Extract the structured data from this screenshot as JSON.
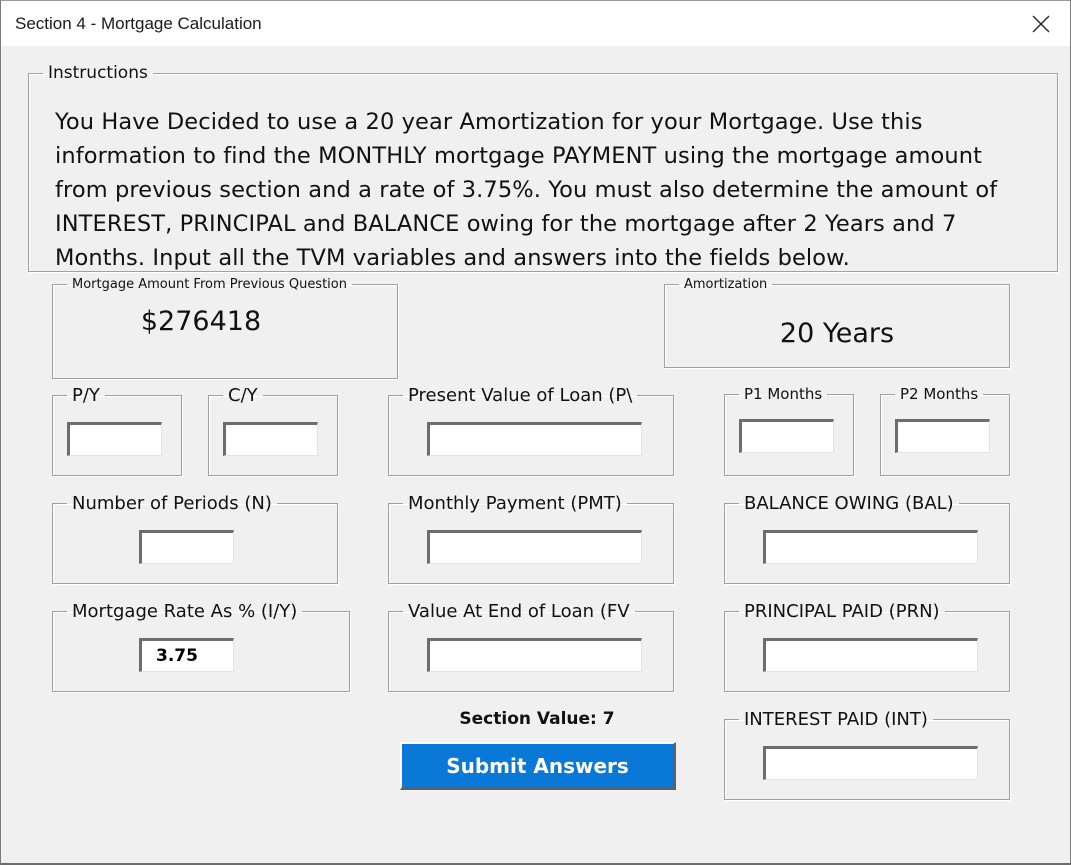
{
  "window": {
    "title": "Section 4 - Mortgage Calculation",
    "close_icon": "close-x-icon"
  },
  "instructions": {
    "legend": "Instructions",
    "lines": [
      "You Have Decided to use a 20 year Amortization for your Mortgage. Use this",
      "information to find the MONTHLY mortgage PAYMENT using the mortgage amount",
      "from previous section and a rate of 3.75%. You must also determine the amount of",
      "INTEREST, PRINCIPAL and BALANCE owing for the mortgage after 2 Years and 7",
      "Months. Input all the TVM variables and answers into the fields below."
    ]
  },
  "mortgage_amount": {
    "legend": "Mortgage Amount From Previous Question",
    "value": "$276418"
  },
  "amortization": {
    "legend": "Amortization",
    "value": "20 Years"
  },
  "fields": {
    "py": {
      "legend": "P/Y",
      "value": ""
    },
    "cy": {
      "legend": "C/Y",
      "value": ""
    },
    "pv": {
      "legend": "Present Value of Loan (P\\",
      "value": ""
    },
    "p1": {
      "legend": "P1 Months",
      "value": ""
    },
    "p2": {
      "legend": "P2 Months",
      "value": ""
    },
    "n": {
      "legend": "Number of Periods (N)",
      "value": ""
    },
    "pmt": {
      "legend": "Monthly Payment (PMT)",
      "value": ""
    },
    "bal": {
      "legend": "BALANCE OWING (BAL)",
      "value": ""
    },
    "iy": {
      "legend": "Mortgage Rate As % (I/Y)",
      "value": "3.75"
    },
    "fv": {
      "legend": "Value At End of Loan (FV",
      "value": ""
    },
    "prn": {
      "legend": "PRINCIPAL PAID  (PRN)",
      "value": ""
    },
    "int": {
      "legend": "INTEREST PAID  (INT)",
      "value": ""
    }
  },
  "section_value": "Section Value: 7",
  "submit": {
    "label": "Submit Answers",
    "color": "#0a78d7"
  }
}
